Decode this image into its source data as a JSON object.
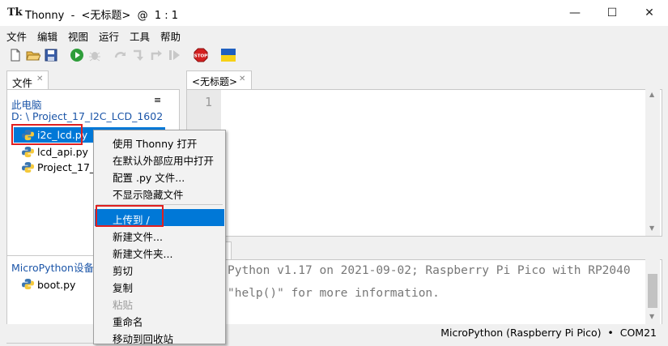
{
  "window": {
    "app_name": "Thonny",
    "title": "Thonny  -  <无标题>  @  1 : 1",
    "controls": [
      "minimize-icon",
      "maximize-icon",
      "close-icon"
    ]
  },
  "menubar": [
    "文件",
    "编辑",
    "视图",
    "运行",
    "工具",
    "帮助"
  ],
  "toolbar": {
    "icons": [
      "new-file-icon",
      "open-folder-icon",
      "save-icon",
      "run-icon",
      "debug-icon",
      "step-over-icon",
      "step-into-icon",
      "step-out-icon",
      "resume-icon",
      "stop-icon",
      "ukraine-flag-icon"
    ],
    "stop_label": "STOP"
  },
  "files": {
    "tab_label": "文件",
    "computer_header": "此电脑",
    "path": "D: \\ Project_17_I2C_LCD_1602",
    "local_files": [
      "i2c_lcd.py",
      "lcd_api.py",
      "Project_17_I2"
    ],
    "device_header": "MicroPython设备",
    "device_files": [
      "boot.py"
    ]
  },
  "editor": {
    "tab_label": "<无标题>",
    "line_number": "1"
  },
  "shell": {
    "lines": [
      "Python v1.17 on 2021-09-02; Raspberry Pi Pico with RP2040",
      "\"help()\" for more information."
    ]
  },
  "context_menu": {
    "items": [
      {
        "label": "使用 Thonny 打开",
        "enabled": true
      },
      {
        "label": "在默认外部应用中打开",
        "enabled": true
      },
      {
        "label": "配置 .py 文件...",
        "enabled": true
      },
      {
        "label": "不显示隐藏文件",
        "enabled": true
      },
      {
        "label": "上传到 /",
        "enabled": true,
        "highlighted": true
      },
      {
        "label": "新建文件...",
        "enabled": true
      },
      {
        "label": "新建文件夹...",
        "enabled": true
      },
      {
        "label": "剪切",
        "enabled": true
      },
      {
        "label": "复制",
        "enabled": true
      },
      {
        "label": "粘贴",
        "enabled": false
      },
      {
        "label": "重命名",
        "enabled": true
      },
      {
        "label": "移动到回收站",
        "enabled": true
      }
    ]
  },
  "status": {
    "interpreter": "MicroPython (Raspberry Pi Pico)  •  COM21"
  },
  "colors": {
    "highlight": "#0078d7",
    "annotation_box": "#e02020",
    "selection": "#0078d7"
  }
}
